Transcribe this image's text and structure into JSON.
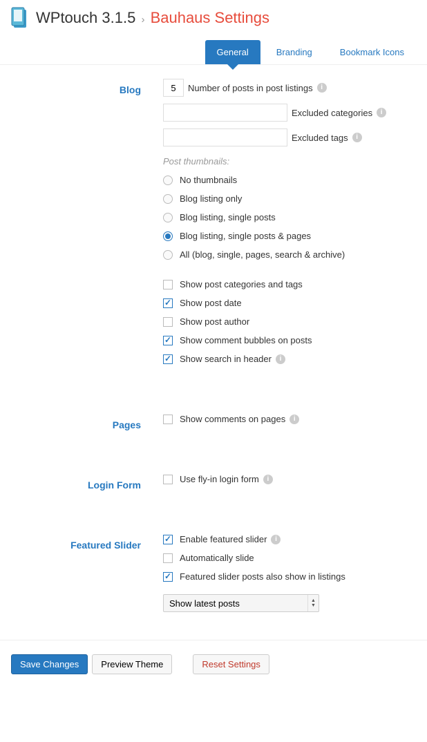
{
  "header": {
    "product": "WPtouch 3.1.5",
    "subtitle": "Bauhaus Settings"
  },
  "tabs": [
    {
      "label": "General",
      "active": true
    },
    {
      "label": "Branding",
      "active": false
    },
    {
      "label": "Bookmark Icons",
      "active": false
    }
  ],
  "sections": {
    "blog": {
      "title": "Blog",
      "posts_count": "5",
      "posts_label": "Number of posts in post listings",
      "excluded_cats_label": "Excluded categories",
      "excluded_tags_label": "Excluded tags",
      "thumbnails_head": "Post thumbnails:",
      "radios": [
        {
          "label": "No thumbnails",
          "checked": false
        },
        {
          "label": "Blog listing only",
          "checked": false
        },
        {
          "label": "Blog listing, single posts",
          "checked": false
        },
        {
          "label": "Blog listing, single posts & pages",
          "checked": true
        },
        {
          "label": "All (blog, single, pages, search & archive)",
          "checked": false
        }
      ],
      "checks": [
        {
          "label": "Show post categories and tags",
          "checked": false,
          "info": false
        },
        {
          "label": "Show post date",
          "checked": true,
          "info": false
        },
        {
          "label": "Show post author",
          "checked": false,
          "info": false
        },
        {
          "label": "Show comment bubbles on posts",
          "checked": true,
          "info": false
        },
        {
          "label": "Show search in header",
          "checked": true,
          "info": true
        }
      ]
    },
    "pages": {
      "title": "Pages",
      "checks": [
        {
          "label": "Show comments on pages",
          "checked": false,
          "info": true
        }
      ]
    },
    "login": {
      "title": "Login Form",
      "checks": [
        {
          "label": "Use fly-in login form",
          "checked": false,
          "info": true
        }
      ]
    },
    "slider": {
      "title": "Featured Slider",
      "checks": [
        {
          "label": "Enable featured slider",
          "checked": true,
          "info": true
        },
        {
          "label": "Automatically slide",
          "checked": false,
          "info": false
        },
        {
          "label": "Featured slider posts also show in listings",
          "checked": true,
          "info": false
        }
      ],
      "select_value": "Show latest posts"
    }
  },
  "footer": {
    "save": "Save Changes",
    "preview": "Preview Theme",
    "reset": "Reset Settings"
  }
}
